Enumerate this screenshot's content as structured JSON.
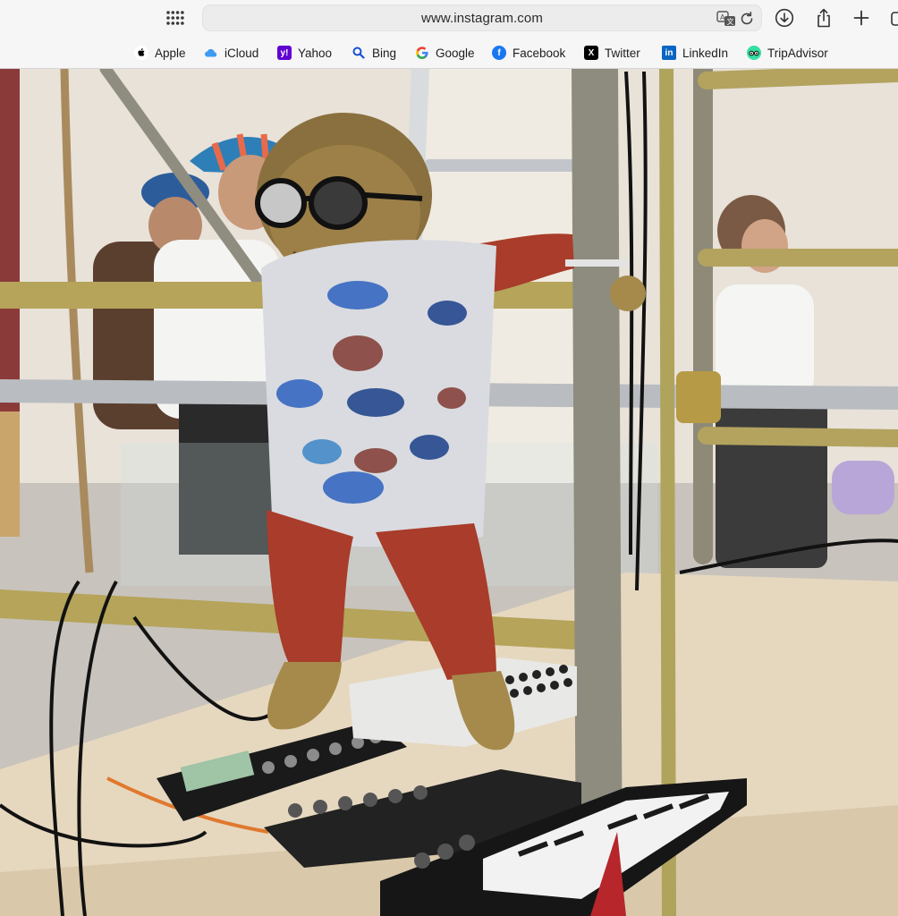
{
  "browser": {
    "url": "www.instagram.com",
    "toolbar_icons": [
      "grid-icon",
      "translate-icon",
      "reload-icon",
      "download-icon",
      "share-icon",
      "new-tab-icon",
      "tabs-icon"
    ]
  },
  "favorites": [
    {
      "label": "Apple",
      "icon": "apple-icon",
      "color": "#000000"
    },
    {
      "label": "iCloud",
      "icon": "icloud-icon",
      "color": "#3d9bf0"
    },
    {
      "label": "Yahoo",
      "icon": "yahoo-icon",
      "color": "#6001d2"
    },
    {
      "label": "Bing",
      "icon": "bing-search-icon",
      "color": "#1a4fd6"
    },
    {
      "label": "Google",
      "icon": "google-icon",
      "color": "#4285f4"
    },
    {
      "label": "Facebook",
      "icon": "facebook-icon",
      "color": "#1877f2"
    },
    {
      "label": "Twitter",
      "icon": "x-twitter-icon",
      "color": "#000000"
    },
    {
      "label": "LinkedIn",
      "icon": "linkedin-icon",
      "color": "#0a66c2"
    },
    {
      "label": "TripAdvisor",
      "icon": "tripadvisor-icon",
      "color": "#34e0a1"
    }
  ],
  "photo": {
    "subject": "doll-in-sunglasses-on-scaffolding"
  }
}
